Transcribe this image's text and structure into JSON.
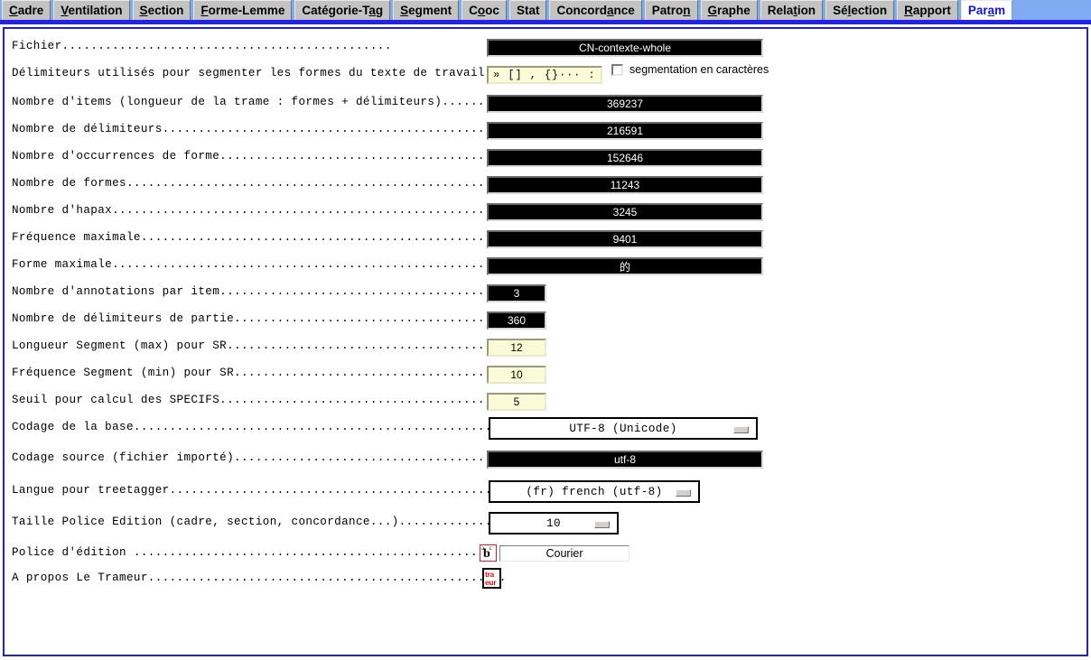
{
  "window": {
    "tab_bar_bg": "#80abf0",
    "tab_strip_color": "#2222ee",
    "panel_border_color": "#2222cc"
  },
  "tabs": [
    {
      "label": "Cadre",
      "accel_index": 0,
      "active": false
    },
    {
      "label": "Ventilation",
      "accel_index": 0,
      "active": false
    },
    {
      "label": "Section",
      "accel_index": 0,
      "active": false
    },
    {
      "label": "Forme-Lemme",
      "accel_index": 0,
      "active": false
    },
    {
      "label": "Catégorie-Tag",
      "accel_index": 11,
      "active": false
    },
    {
      "label": "Segment",
      "accel_index": 0,
      "active": false
    },
    {
      "label": "Cooc",
      "accel_index": 1,
      "active": false
    },
    {
      "label": "Stat",
      "accel_index": -1,
      "active": false
    },
    {
      "label": "Concordance",
      "accel_index": 7,
      "active": false
    },
    {
      "label": "Patron",
      "accel_index": 5,
      "active": false
    },
    {
      "label": "Graphe",
      "accel_index": 0,
      "active": false
    },
    {
      "label": "Relation",
      "accel_index": 4,
      "active": false
    },
    {
      "label": "Sélection",
      "accel_index": 2,
      "active": false
    },
    {
      "label": "Rapport",
      "accel_index": 0,
      "active": false
    },
    {
      "label": "Param",
      "accel_index": 3,
      "active": true
    }
  ],
  "rows": [
    {
      "name": "fichier",
      "label": "Fichier..............................................",
      "field_kind": "lcd",
      "value": "CN-contexte-whole"
    },
    {
      "name": "delimiteurs",
      "label": "Délimiteurs utilisés pour segmenter les formes du texte de travail.......",
      "field_kind": "entry",
      "value": "() » [] , {}··· : /."
    },
    {
      "name": "nombre-items",
      "label": "Nombre d'items (longueur de la trame : formes + délimiteurs).............",
      "field_kind": "lcd",
      "value": "369237"
    },
    {
      "name": "nombre-delimiteurs",
      "label": "Nombre de délimiteurs................................................",
      "field_kind": "lcd",
      "value": "216591"
    },
    {
      "name": "nombre-occurrences-forme",
      "label": "Nombre d'occurrences de forme........................................",
      "field_kind": "lcd",
      "value": "152646"
    },
    {
      "name": "nombre-formes",
      "label": "Nombre de formes.....................................................",
      "field_kind": "lcd",
      "value": "11243"
    },
    {
      "name": "nombre-hapax",
      "label": "Nombre d'hapax.......................................................",
      "field_kind": "lcd",
      "value": "3245"
    },
    {
      "name": "frequence-maximale",
      "label": "Fréquence maximale...................................................",
      "field_kind": "lcd",
      "value": "9401"
    },
    {
      "name": "forme-maximale",
      "label": "Forme maximale.......................................................",
      "field_kind": "lcd",
      "value": "的"
    },
    {
      "name": "nombre-annotations-par-item",
      "label": "Nombre d'annotations par item........................................",
      "field_kind": "lcd-short",
      "value": "3"
    },
    {
      "name": "nombre-delimiteurs-de-partie",
      "label": "Nombre de délimiteurs de partie......................................",
      "field_kind": "lcd-short",
      "value": "360"
    },
    {
      "name": "longueur-segment-max-sr",
      "label": "Longueur Segment (max) pour SR.......................................",
      "field_kind": "entry-short",
      "value": "12"
    },
    {
      "name": "frequence-segment-min-sr",
      "label": "Fréquence Segment (min) pour SR......................................",
      "field_kind": "entry-short",
      "value": "10"
    },
    {
      "name": "seuil-specifs",
      "label": "Seuil pour calcul des SPECIFS........................................",
      "field_kind": "entry-short",
      "value": "5"
    },
    {
      "name": "codage-base",
      "label": "Codage de la base....................................................",
      "field_kind": "optmenu-wide",
      "value": "UTF-8 (Unicode)"
    },
    {
      "name": "codage-source",
      "label": "Codage source (fichier importé)......................................",
      "field_kind": "lcd",
      "value": "utf-8"
    },
    {
      "name": "langue-treetagger",
      "label": "Langue pour treetagger...............................................",
      "field_kind": "optmenu-med",
      "value": "(fr) french (utf-8)"
    },
    {
      "name": "taille-police-edition",
      "label": "Taille Police Edition (cadre, section, concordance...)................",
      "field_kind": "optmenu-small",
      "value": "10"
    },
    {
      "name": "police-edition",
      "label": "Police d'édition ....................................................",
      "field_kind": "font-picker",
      "value": "Courier"
    },
    {
      "name": "a-propos-trameur",
      "label": "A propos Le Trameur..................................................",
      "field_kind": "about-icon",
      "value": ""
    }
  ],
  "checkbox": {
    "label": "segmentation en caractères",
    "checked": false
  },
  "icons": {
    "font_picker_icon": "ab-font-icon",
    "about_icon_line1": "tra",
    "about_icon_line2": "eur"
  }
}
